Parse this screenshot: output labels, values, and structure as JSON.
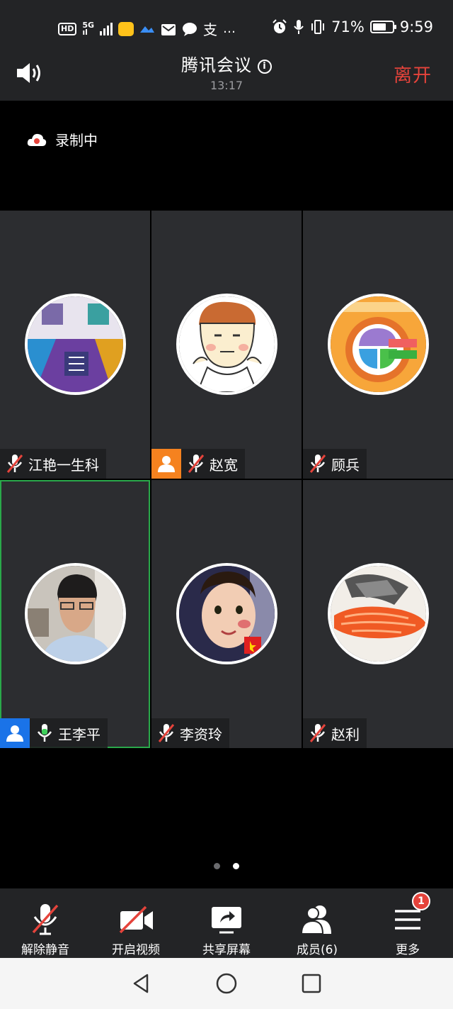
{
  "status_bar": {
    "left_icons": [
      "hd-badge",
      "5g-signal-icon",
      "signal-bars-icon",
      "app-icon",
      "mail-icon",
      "chat-bubble-icon",
      "alipay-icon",
      "more-dots-icon"
    ],
    "battery_percent": "71%",
    "battery_level": 0.71,
    "time": "9:59"
  },
  "header": {
    "title": "腾讯会议",
    "duration": "13:17",
    "leave_label": "离开"
  },
  "recording": {
    "label": "录制中"
  },
  "participants": [
    {
      "name": "江艳一生科",
      "muted": true,
      "role_badge": null,
      "avatar": "poster-avatar"
    },
    {
      "name": "赵宽",
      "muted": true,
      "role_badge": "orange",
      "avatar": "cartoon-avatar"
    },
    {
      "name": "顾兵",
      "muted": true,
      "role_badge": null,
      "avatar": "diagram-avatar"
    },
    {
      "name": "王李平",
      "muted": false,
      "role_badge": "blue",
      "avatar": "photo-avatar",
      "active_speaker": true
    },
    {
      "name": "李资玲",
      "muted": true,
      "role_badge": null,
      "avatar": "child-photo-avatar"
    },
    {
      "name": "赵利",
      "muted": true,
      "role_badge": null,
      "avatar": "fish-avatar"
    }
  ],
  "pagination": {
    "pages": 2,
    "current": 2
  },
  "toolbar": {
    "unmute_label": "解除静音",
    "video_label": "开启视频",
    "share_label": "共享屏幕",
    "members_label": "成员(6)",
    "more_label": "更多",
    "more_badge": "1"
  },
  "colors": {
    "leave": "#e5433b",
    "active_border": "#2aa84a",
    "host_badge": "#f5821f",
    "cohost_badge": "#1a73e8"
  }
}
